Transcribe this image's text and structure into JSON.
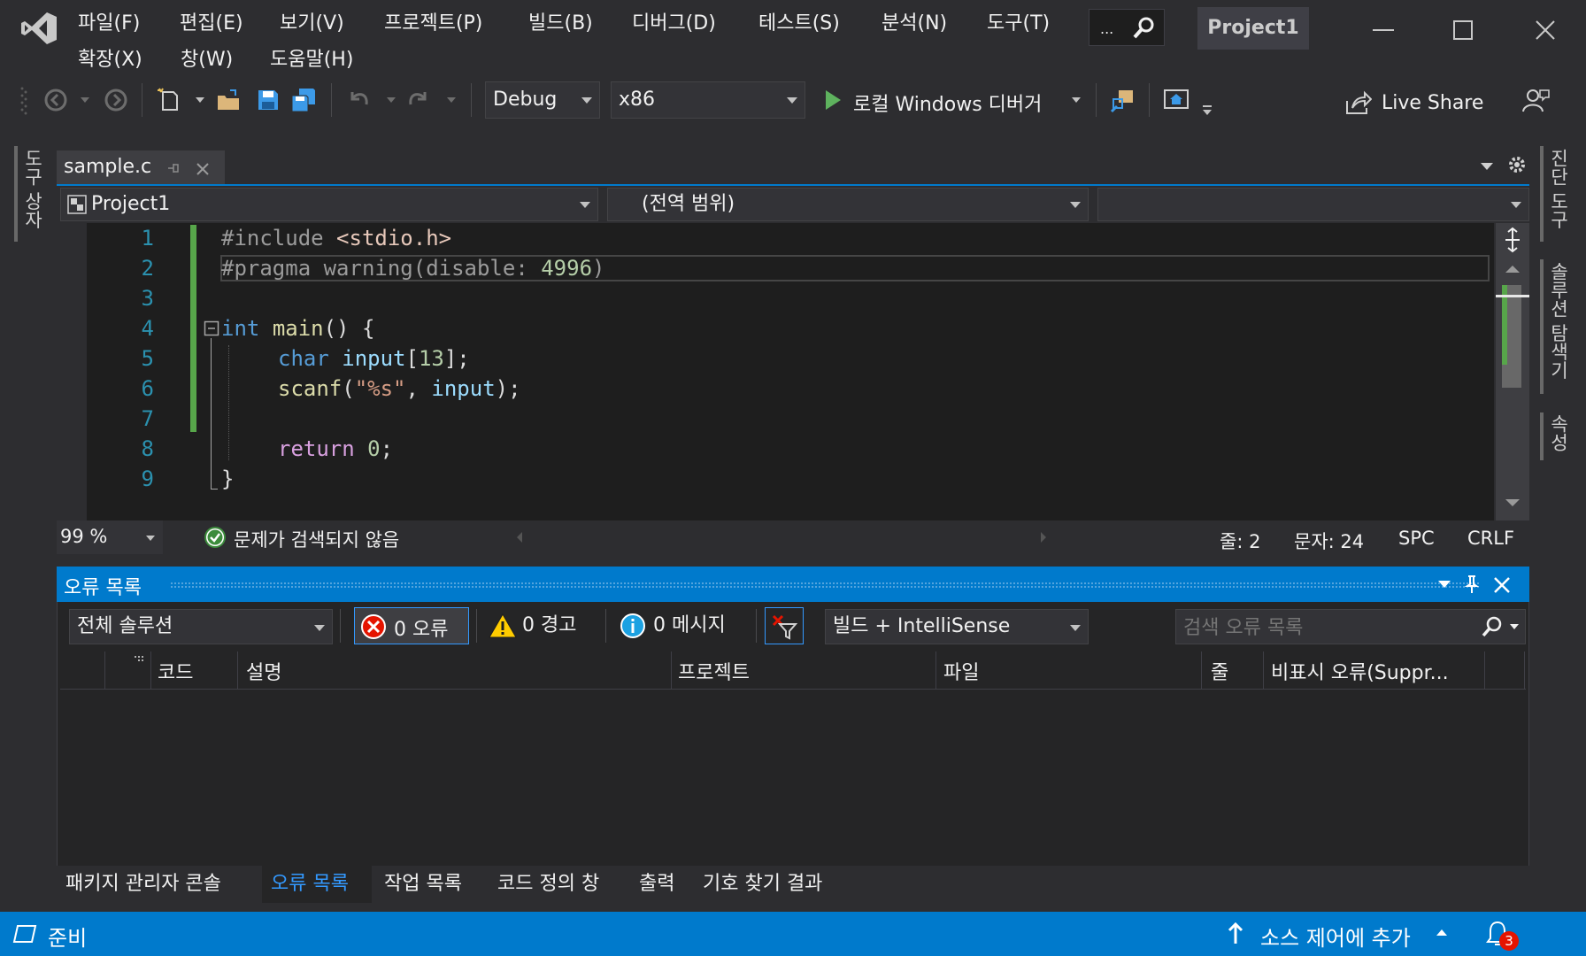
{
  "menu": {
    "items": [
      "파일(F)",
      "편집(E)",
      "보기(V)",
      "프로젝트(P)",
      "빌드(B)",
      "디버그(D)",
      "테스트(S)",
      "분석(N)",
      "도구(T)",
      "확장(X)",
      "창(W)",
      "도움말(H)"
    ],
    "search_label": "...",
    "project_title": "Project1"
  },
  "toolbar": {
    "config": "Debug",
    "platform": "x86",
    "run_label": "로컬 Windows 디버거",
    "live_share": "Live Share"
  },
  "left_rail": {
    "label": "도구 상자"
  },
  "right_rail": {
    "labels": [
      "진단 도구",
      "솔루션 탐색기",
      "속성"
    ]
  },
  "document": {
    "tab_name": "sample.c",
    "nav_project": "Project1",
    "nav_scope": "(전역 범위)",
    "nav_member": "",
    "line_numbers": [
      "1",
      "2",
      "3",
      "4",
      "5",
      "6",
      "7",
      "8",
      "9"
    ],
    "code": {
      "l1a": "#include ",
      "l1b": "<stdio.h>",
      "l2a": "#pragma warning(disable: ",
      "l2b": "4996",
      "l2c": ")",
      "l4a": "int",
      "l4b": " ",
      "l4c": "main",
      "l4d": "() {",
      "l5a": "char",
      "l5b": " ",
      "l5c": "input",
      "l5d": "[",
      "l5e": "13",
      "l5f": "];",
      "l6a": "scanf",
      "l6b": "(",
      "l6c": "\"%s\"",
      "l6d": ", ",
      "l6e": "input",
      "l6f": ");",
      "l8a": "return",
      "l8b": " ",
      "l8c": "0",
      "l8d": ";",
      "l9a": "}"
    }
  },
  "editor_status": {
    "zoom": "99 %",
    "issues": "문제가 검색되지 않음",
    "line": "줄: 2",
    "char": "문자: 24",
    "spc": "SPC",
    "crlf": "CRLF"
  },
  "error_list": {
    "title": "오류 목록",
    "scope": "전체 솔루션",
    "errors": "0 오류",
    "warnings": "0 경고",
    "messages": "0 메시지",
    "source": "빌드 + IntelliSense",
    "search_placeholder": "검색 오류 목록",
    "columns": [
      "코드",
      "설명",
      "프로젝트",
      "파일",
      "줄",
      "비표시 오류(Suppr..."
    ]
  },
  "bottom_tabs": [
    "패키지 관리자 콘솔",
    "오류 목록",
    "작업 목록",
    "코드 정의 창",
    "출력",
    "기호 찾기 결과"
  ],
  "status_bar": {
    "ready": "준비",
    "source_control": "소스 제어에 추가",
    "notifications": "3"
  },
  "colors": {
    "accent": "#007acc",
    "background": "#2d2d30",
    "editor": "#1e1e1e",
    "keyword": "#569cd6",
    "line_number": "#2b91af",
    "changed_lines": "#57a64a",
    "badge": "#e51400"
  }
}
